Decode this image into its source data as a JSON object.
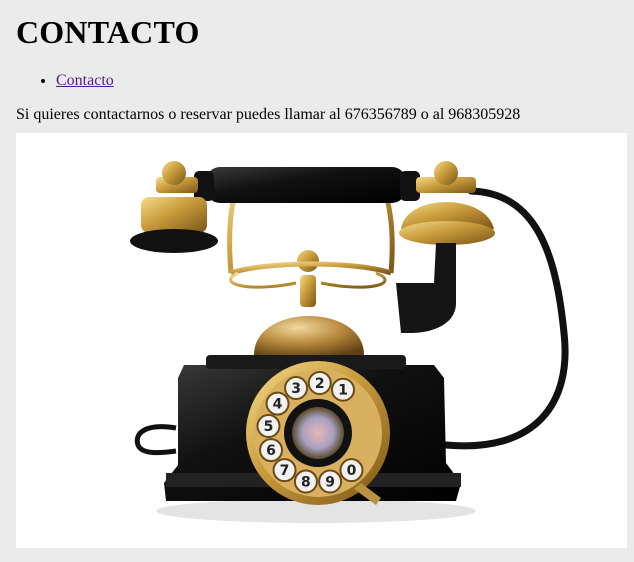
{
  "header": {
    "title": "CONTACTO"
  },
  "nav": {
    "items": [
      {
        "label": "Contacto"
      }
    ]
  },
  "main": {
    "intro": "Si quieres contactarnos o reservar puedes llamar al 676356789 o al 968305928"
  },
  "image": {
    "subject": "antique-rotary-telephone",
    "dial_digits": [
      "1",
      "2",
      "3",
      "4",
      "5",
      "6",
      "7",
      "8",
      "9",
      "0"
    ]
  },
  "colors": {
    "page_background": "#ebebeb",
    "visited_link": "#551a8b",
    "brass": "#c89b3c",
    "bakelite": "#141414"
  }
}
